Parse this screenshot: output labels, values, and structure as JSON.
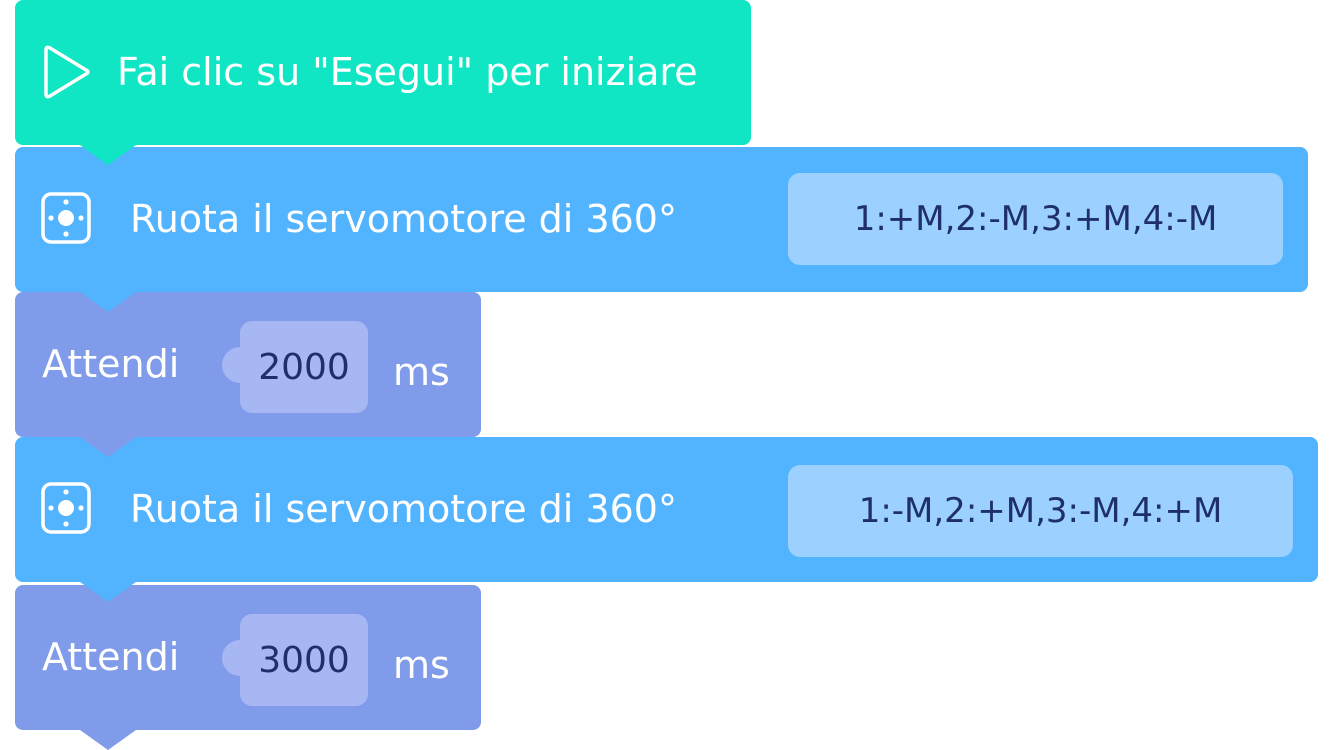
{
  "program": {
    "start_block": {
      "label": "Fai clic su \"Esegui\" per iniziare",
      "icon": "play-icon",
      "color": "#10e6c4"
    },
    "blocks": [
      {
        "type": "servo",
        "label": "Ruota il servomotore di 360°",
        "value": "1:+M,2:-M,3:+M,4:-M",
        "icon": "servo-icon",
        "color": "#52b4fe"
      },
      {
        "type": "wait",
        "label": "Attendi",
        "value": "2000",
        "unit": "ms",
        "color": "#7f9be9"
      },
      {
        "type": "servo",
        "label": "Ruota il servomotore di 360°",
        "value": "1:-M,2:+M,3:-M,4:+M",
        "icon": "servo-icon",
        "color": "#52b4fe"
      },
      {
        "type": "wait",
        "label": "Attendi",
        "value": "3000",
        "unit": "ms",
        "color": "#7f9be9"
      }
    ]
  }
}
